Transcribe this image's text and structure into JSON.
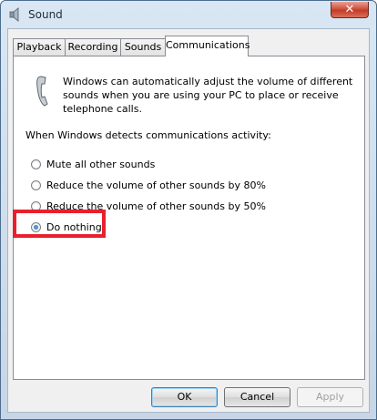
{
  "window": {
    "title": "Sound",
    "close_label": "✕"
  },
  "tabs": [
    {
      "label": "Playback"
    },
    {
      "label": "Recording"
    },
    {
      "label": "Sounds"
    },
    {
      "label": "Communications"
    }
  ],
  "active_tab": "Communications",
  "panel": {
    "description": "Windows can automatically adjust the volume of different sounds when you are using your PC to place or receive telephone calls.",
    "prompt": "When Windows detects communications activity:",
    "options": [
      {
        "label": "Mute all other sounds",
        "checked": false
      },
      {
        "label": "Reduce the volume of other sounds by 80%",
        "checked": false
      },
      {
        "label": "Reduce the volume of other sounds by 50%",
        "checked": false
      },
      {
        "label": "Do nothing",
        "checked": true
      }
    ]
  },
  "buttons": {
    "ok": "OK",
    "cancel": "Cancel",
    "apply": "Apply"
  },
  "colors": {
    "highlight": "#e8202e"
  }
}
